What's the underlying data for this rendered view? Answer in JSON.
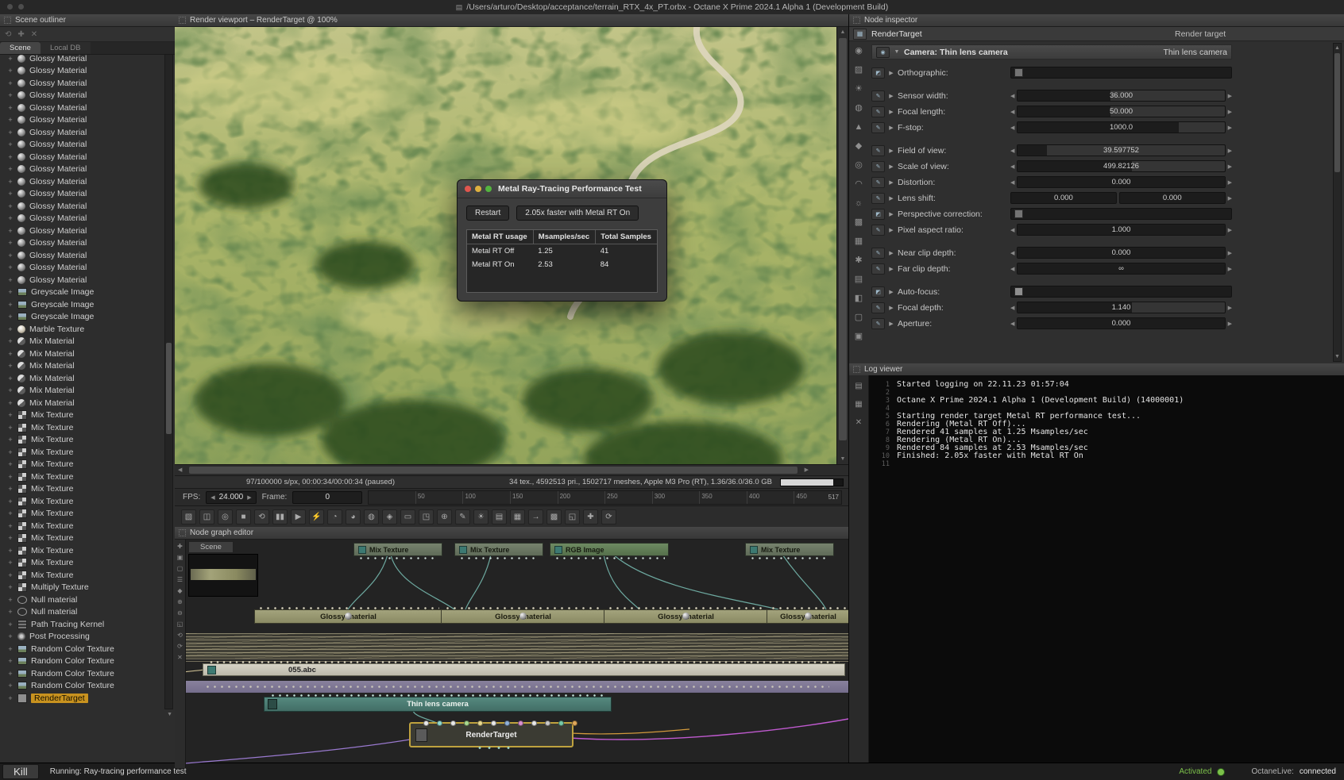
{
  "colors": {
    "sel": "#c8921f",
    "activated": "#7cc14a",
    "traffic-red": "#e0564e",
    "traffic-yellow": "#dfb13f",
    "traffic-green": "#54b43f"
  },
  "window": {
    "title": "/Users/arturo/Desktop/acceptance/terrain_RTX_4x_PT.orbx - Octane X Prime 2024.1 Alpha 1 (Development Build)"
  },
  "scene_outliner": {
    "title": "Scene outliner",
    "tabs": [
      "Scene",
      "Local DB"
    ],
    "tool_icons": [
      {
        "name": "refresh-icon",
        "glyph": "⟲"
      },
      {
        "name": "add-item-icon",
        "glyph": "✚"
      },
      {
        "name": "delete-item-icon",
        "glyph": "✕"
      }
    ],
    "groups": [
      {
        "label": "Glossy Material",
        "icon": "sphere",
        "count": 19
      },
      {
        "label": "Greyscale Image",
        "icon": "image",
        "count": 3
      },
      {
        "label": "Marble Texture",
        "icon": "marble",
        "count": 1
      },
      {
        "label": "Mix Material",
        "icon": "mix-material",
        "count": 6
      },
      {
        "label": "Mix Texture",
        "icon": "mix-texture",
        "count": 14
      },
      {
        "label": "Multiply Texture",
        "icon": "multiply-texture",
        "count": 1
      },
      {
        "label": "Null material",
        "icon": "null-material",
        "count": 2
      },
      {
        "label": "Path Tracing Kernel",
        "icon": "kernel",
        "count": 1
      },
      {
        "label": "Post Processing",
        "icon": "post-processing",
        "count": 1
      },
      {
        "label": "Random Color Texture",
        "icon": "image",
        "count": 4
      },
      {
        "label": "RenderTarget",
        "icon": "render-target",
        "count": 1,
        "selected": true
      }
    ]
  },
  "viewport": {
    "title": "Render viewport – RenderTarget @ 100%",
    "status_left": "97/100000 s/px, 00:00:34/00:00:34 (paused)",
    "status_right": "34 tex., 4592513 pri., 1502717 meshes, Apple M3 Pro (RT), 1.36/36.0/36.0 GB",
    "fps_label": "FPS:",
    "fps_value": "24.000",
    "frame_label": "Frame:",
    "frame_value": "0",
    "timeline_ticks": [
      "50",
      "100",
      "150",
      "200",
      "250",
      "300",
      "350",
      "400",
      "450"
    ],
    "timeline_end": "517",
    "toolbar_icons": [
      {
        "name": "camera-view-icon",
        "glyph": "▧"
      },
      {
        "name": "lock-camera-icon",
        "glyph": "◫"
      },
      {
        "name": "recenter-icon",
        "glyph": "◎"
      },
      {
        "name": "stop-render-icon",
        "glyph": "■"
      },
      {
        "name": "restart-render-icon",
        "glyph": "⟲"
      },
      {
        "name": "pause-render-icon",
        "glyph": "▮▮"
      },
      {
        "name": "play-render-icon",
        "glyph": "▶"
      },
      {
        "name": "realtime-icon",
        "glyph": "⚡"
      },
      {
        "name": "subsample-icon",
        "glyph": "◔"
      },
      {
        "name": "clay-mode-icon",
        "glyph": "◕"
      },
      {
        "name": "denoise-icon",
        "glyph": "◍"
      },
      {
        "name": "upsample-icon",
        "glyph": "◈"
      },
      {
        "name": "region-render-icon",
        "glyph": "▭"
      },
      {
        "name": "film-region-icon",
        "glyph": "◳"
      },
      {
        "name": "pick-focus-icon",
        "glyph": "⊕"
      },
      {
        "name": "pick-material-icon",
        "glyph": "✎"
      },
      {
        "name": "pick-white-point-icon",
        "glyph": "☀"
      },
      {
        "name": "copy-frame-icon",
        "glyph": "▤"
      },
      {
        "name": "save-frame-icon",
        "glyph": "▦"
      },
      {
        "name": "export-icon",
        "glyph": "→"
      },
      {
        "name": "background-image-icon",
        "glyph": "▩"
      },
      {
        "name": "zoom-fit-icon",
        "glyph": "◱"
      },
      {
        "name": "pan-icon",
        "glyph": "✚"
      },
      {
        "name": "orbit-icon",
        "glyph": "⟳"
      }
    ]
  },
  "dialog": {
    "title": "Metal Ray-Tracing Performance Test",
    "restart_label": "Restart",
    "result_label": "2.05x faster with Metal RT On",
    "table": {
      "headers": [
        "Metal RT usage",
        "Msamples/sec",
        "Total Samples"
      ],
      "rows": [
        [
          "Metal RT Off",
          "1.25",
          "41"
        ],
        [
          "Metal RT On",
          "2.53",
          "84"
        ]
      ]
    }
  },
  "node_graph": {
    "title": "Node graph editor",
    "tab": "Scene",
    "top_nodes": [
      "Mix Texture",
      "Mix Texture",
      "RGB Image",
      "Mix Texture"
    ],
    "glossy_label": "Glossy material",
    "abc_label": "055.abc",
    "camera_label": "Thin lens camera",
    "rt_label": "RenderTarget",
    "rt_pin_colors": [
      "#e8e8e8",
      "#8fd8d0",
      "#e8e8e8",
      "#a9d88f",
      "#e8d88f",
      "#e8e8e8",
      "#8fb0d8",
      "#d88fd0",
      "#e8e8e8",
      "#c9c9c9",
      "#76c9a8",
      "#e0a85a"
    ],
    "strip_icons": [
      {
        "name": "add-node-icon",
        "glyph": "✚"
      },
      {
        "name": "group-nodes-icon",
        "glyph": "▣"
      },
      {
        "name": "ungroup-icon",
        "glyph": "▢"
      },
      {
        "name": "align-icon",
        "glyph": "☰"
      },
      {
        "name": "snap-icon",
        "glyph": "◆"
      },
      {
        "name": "zoom-in-icon",
        "glyph": "⊕"
      },
      {
        "name": "zoom-out-icon",
        "glyph": "⊖"
      },
      {
        "name": "fit-view-icon",
        "glyph": "◱"
      },
      {
        "name": "undo-icon",
        "glyph": "⟲"
      },
      {
        "name": "redo-icon",
        "glyph": "⟳"
      },
      {
        "name": "delete-node-icon",
        "glyph": "✕"
      }
    ]
  },
  "inspector": {
    "title": "Node inspector",
    "node_name": "RenderTarget",
    "node_type": "Render target",
    "camera_label": "Camera:  Thin lens camera",
    "camera_type": "Thin lens camera",
    "gutter_icons": [
      {
        "name": "material-ball-icon",
        "glyph": "◉"
      },
      {
        "name": "texture-icon",
        "glyph": "▨"
      },
      {
        "name": "emission-icon",
        "glyph": "☀"
      },
      {
        "name": "medium-icon",
        "glyph": "◍"
      },
      {
        "name": "displacement-icon",
        "glyph": "▲"
      },
      {
        "name": "geometry-icon",
        "glyph": "◆"
      },
      {
        "name": "camera-icon",
        "glyph": "◎"
      },
      {
        "name": "environment-icon",
        "glyph": "◠"
      },
      {
        "name": "light-icon",
        "glyph": "☼"
      },
      {
        "name": "kernel-icon",
        "glyph": "▩"
      },
      {
        "name": "imager-icon",
        "glyph": "▦"
      },
      {
        "name": "postfx-icon",
        "glyph": "✱"
      },
      {
        "name": "render-passes-icon",
        "glyph": "▤"
      },
      {
        "name": "aov-icon",
        "glyph": "◧"
      },
      {
        "name": "object-layer-icon",
        "glyph": "▢"
      },
      {
        "name": "preview-icon",
        "glyph": "▣"
      }
    ],
    "params": [
      {
        "label": "Orthographic:",
        "type": "checkbox",
        "checked": false
      },
      {
        "label": "Sensor width:",
        "type": "slider",
        "value": "36.000",
        "fill": 0.45,
        "gap": true
      },
      {
        "label": "Focal length:",
        "type": "slider",
        "value": "50.000",
        "fill": 0.45
      },
      {
        "label": "F-stop:",
        "type": "slider",
        "value": "1000.0",
        "fill": 0.78
      },
      {
        "label": "Field of view:",
        "type": "slider",
        "value": "39.597752",
        "fill": 0.14,
        "gap": true
      },
      {
        "label": "Scale of view:",
        "type": "slider",
        "value": "499.82126",
        "fill": 0.55
      },
      {
        "label": "Distortion:",
        "type": "slider",
        "value": "0.000",
        "fill": 1
      },
      {
        "label": "Lens shift:",
        "type": "dual",
        "value": "0.000",
        "value2": "0.000"
      },
      {
        "label": "Perspective correction:",
        "type": "checkbox",
        "checked": false
      },
      {
        "label": "Pixel aspect ratio:",
        "type": "slider",
        "value": "1.000",
        "fill": 1
      },
      {
        "label": "Near clip depth:",
        "type": "slider",
        "value": "0.000",
        "fill": 1,
        "gap": true
      },
      {
        "label": "Far clip depth:",
        "type": "slider",
        "value": "∞",
        "fill": 1
      },
      {
        "label": "Auto-focus:",
        "type": "checkbox",
        "checked": true,
        "gap": true
      },
      {
        "label": "Focal depth:",
        "type": "slider",
        "value": "1.140",
        "fill": 0.55
      },
      {
        "label": "Aperture:",
        "type": "slider",
        "value": "0.000",
        "fill": 1
      }
    ]
  },
  "log": {
    "title": "Log viewer",
    "gutter_icons": [
      {
        "name": "copy-log-icon",
        "glyph": "▤"
      },
      {
        "name": "save-log-icon",
        "glyph": "▦"
      },
      {
        "name": "clear-log-icon",
        "glyph": "✕"
      }
    ],
    "lines": [
      {
        "num": "1",
        "text": "Started logging on 22.11.23 01:57:04"
      },
      {
        "num": "2",
        "text": ""
      },
      {
        "num": "3",
        "text": "Octane X Prime 2024.1 Alpha 1 (Development Build) (14000001)"
      },
      {
        "num": "4",
        "text": ""
      },
      {
        "num": "5",
        "text": "Starting render target Metal RT performance test..."
      },
      {
        "num": "6",
        "text": "Rendering (Metal RT Off)..."
      },
      {
        "num": "7",
        "text": "Rendered 41 samples at 1.25 Msamples/sec"
      },
      {
        "num": "8",
        "text": "Rendering (Metal RT On)..."
      },
      {
        "num": "9",
        "text": "Rendered 84 samples at 2.53 Msamples/sec"
      },
      {
        "num": "10",
        "text": "Finished: 2.05x faster with Metal RT On"
      },
      {
        "num": "11",
        "text": ""
      }
    ]
  },
  "status_bar": {
    "kill": "Kill",
    "status": "Running: Ray-tracing performance test",
    "activated": "Activated",
    "octanelive_label": "OctaneLive:",
    "octanelive_value": "connected"
  }
}
